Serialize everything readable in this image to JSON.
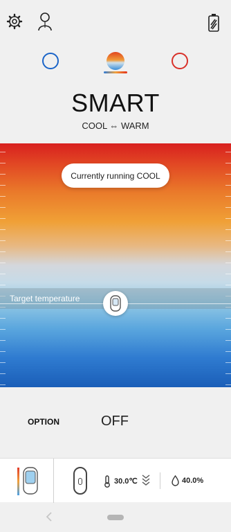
{
  "header": {
    "icons": [
      "gear-icon",
      "person-icon",
      "battery-icon"
    ]
  },
  "modes": [
    {
      "name": "cool",
      "color": "#1a64c8",
      "selected": false
    },
    {
      "name": "smart",
      "selected": true
    },
    {
      "name": "warm",
      "color": "#d83028",
      "selected": false
    }
  ],
  "main": {
    "title": "SMART",
    "subtitle": "COOL ⇔ WARM",
    "status": "Currently running COOL",
    "target_label": "Target temperature"
  },
  "option": {
    "label": "OPTION",
    "value": "OFF"
  },
  "device_status": {
    "temperature": "30.0℃",
    "humidity": "40.0%"
  }
}
